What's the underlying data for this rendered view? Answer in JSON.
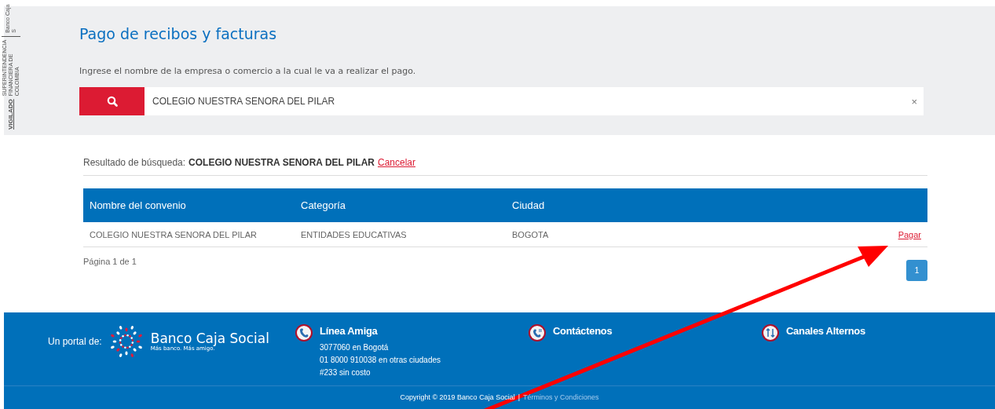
{
  "side_seal": {
    "vigilado": "VIGILADO",
    "entity": "SUPERINTENDENCIA FINANCIERA DE COLOMBIA",
    "brand": "Banco Caja S"
  },
  "header": {
    "title": "Pago de recibos y facturas",
    "instruction": "Ingrese el nombre de la empresa o comercio a la cual le va a realizar el pago.",
    "search_value": "COLEGIO NUESTRA SENORA DEL PILAR",
    "clear": "×"
  },
  "result": {
    "label": "Resultado de búsqueda:",
    "query": "COLEGIO NUESTRA SENORA DEL PILAR",
    "cancel": "Cancelar"
  },
  "table": {
    "columns": [
      "Nombre del convenio",
      "Categoría",
      "Ciudad"
    ],
    "rows": [
      {
        "cells": [
          "COLEGIO NUESTRA SENORA DEL PILAR",
          "ENTIDADES EDUCATIVAS",
          "BOGOTA"
        ],
        "action": "Pagar"
      }
    ]
  },
  "pagination": {
    "summary": "Página 1 de 1",
    "pages": [
      {
        "label": "1",
        "selected": true
      }
    ]
  },
  "footer": {
    "portal_label": "Un portal de:",
    "brand_name": "Banco Caja Social",
    "brand_tagline": "Más banco. Más amigo.",
    "sections": [
      {
        "kind": "phone",
        "title": "Línea Amiga",
        "lines": [
          "3077060 en Bogotá",
          "01 8000 910038 en otras ciudades",
          "#233 sin costo"
        ]
      },
      {
        "kind": "contact",
        "title": "Contáctenos"
      },
      {
        "kind": "channels",
        "title": "Canales Alternos"
      }
    ],
    "copyright": "Copyright © 2019 Banco Caja Social",
    "separator": "|",
    "terms": "Términos y Condiciones"
  }
}
